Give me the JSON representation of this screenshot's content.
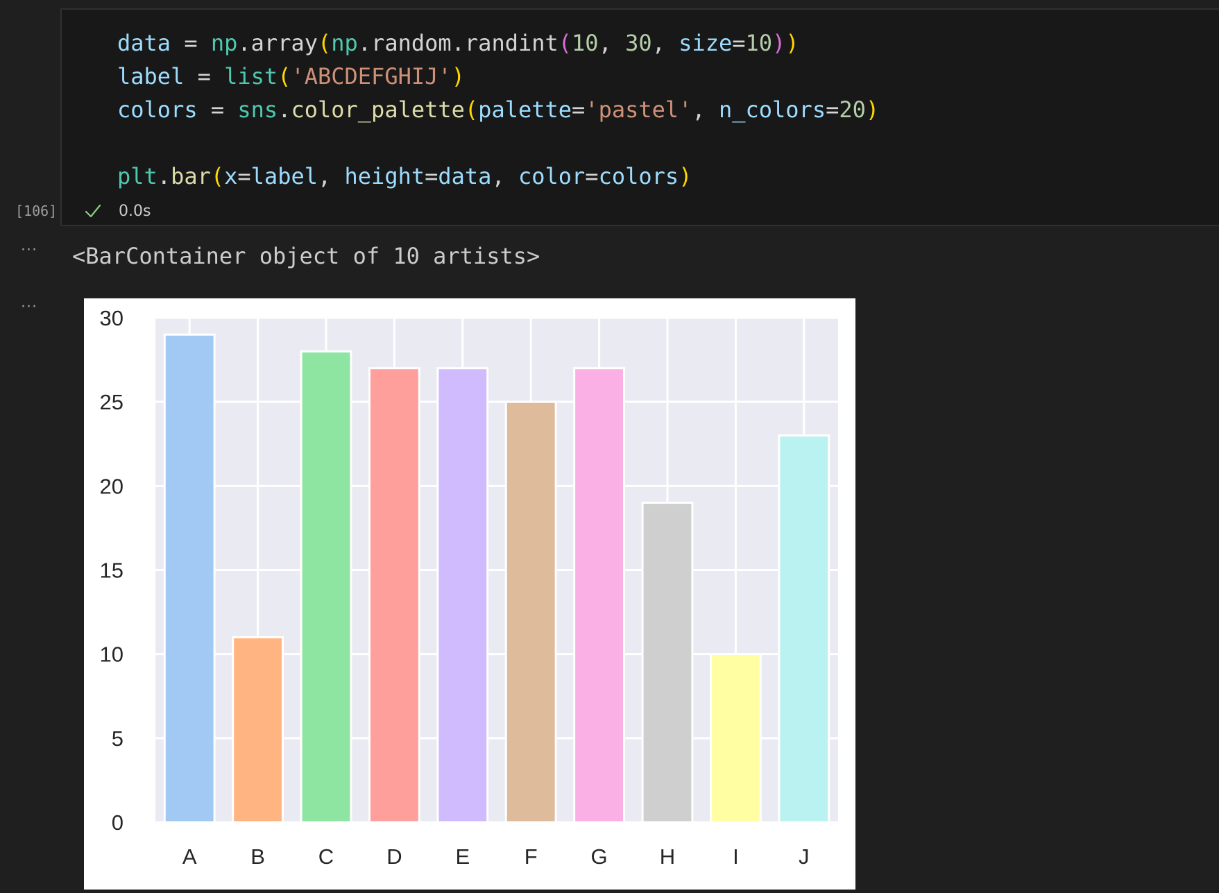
{
  "cell": {
    "execution_count": "[106]",
    "status_icon": "check-icon",
    "elapsed": "0.0s",
    "code_lines": [
      "data = np.array(np.random.randint(10, 30, size=10))",
      "label = list('ABCDEFGHIJ')",
      "colors = sns.color_palette(palette='pastel', n_colors=20)",
      "",
      "plt.bar(x=label, height=data, color=colors)"
    ]
  },
  "output": {
    "more_icon": "ellipsis-icon",
    "text": "<BarContainer object of 10 artists>"
  },
  "chart_data": {
    "type": "bar",
    "categories": [
      "A",
      "B",
      "C",
      "D",
      "E",
      "F",
      "G",
      "H",
      "I",
      "J"
    ],
    "values": [
      29,
      11,
      28,
      27,
      27,
      25,
      27,
      19,
      10,
      23
    ],
    "colors": [
      "#a1c9f4",
      "#ffb482",
      "#8de5a1",
      "#ff9f9b",
      "#d0bbff",
      "#debb9b",
      "#fab0e4",
      "#cfcfcf",
      "#fffea3",
      "#b9f2f0"
    ],
    "ylim": [
      0,
      30
    ],
    "yticks": [
      "0",
      "5",
      "10",
      "15",
      "20",
      "25",
      "30"
    ],
    "grid": true,
    "background": "#eaeaf2",
    "title": "",
    "xlabel": "",
    "ylabel": ""
  }
}
